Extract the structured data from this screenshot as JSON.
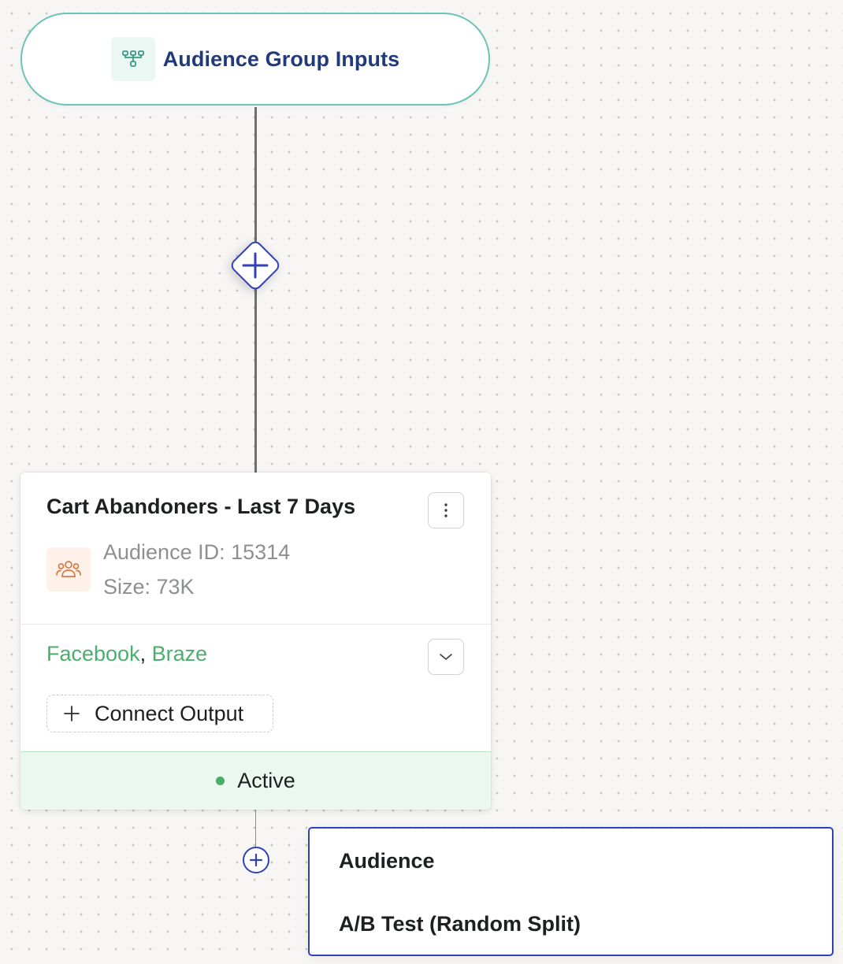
{
  "input_node": {
    "title": "Audience Group Inputs",
    "icon": "hierarchy-icon",
    "border_color": "#6cc4b8",
    "title_color": "#233a79"
  },
  "add_step": {
    "icon": "plus-icon",
    "color": "#3142b8"
  },
  "audience_card": {
    "title": "Cart Abandoners - Last 7 Days",
    "menu_icon": "vertical-dots-icon",
    "audience_icon": "users-icon",
    "audience_id": "Audience ID: 15314",
    "size": "Size: 73K",
    "destinations": [
      "Facebook",
      "Braze"
    ],
    "destination_separator": ", ",
    "destination_color": "#4bae6d",
    "expand_icon": "chevron-down-icon",
    "connect_output_label": "Connect Output",
    "status": "Active",
    "status_color": "#49ad6a"
  },
  "add_menu": {
    "items": [
      {
        "label": "Audience"
      },
      {
        "label": "A/B Test (Random Split)"
      }
    ]
  }
}
